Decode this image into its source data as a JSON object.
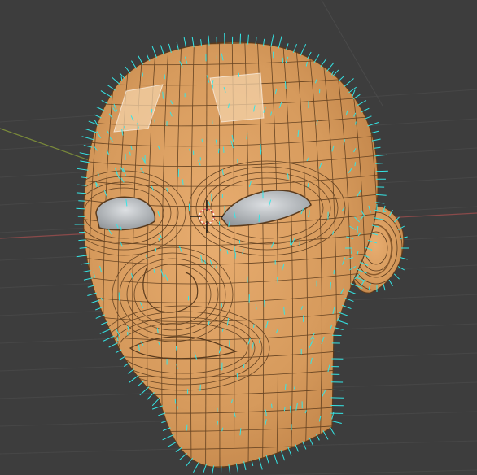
{
  "viewport": {
    "background": "#3d3d3d",
    "grid_color": "#4a4a4a",
    "axis_x_color": "#8a4a4a",
    "axis_y_color": "#7a8a3a",
    "mesh_face_color": "#d69a5c",
    "mesh_edge_color": "#5a3a1c",
    "normal_color": "#35e6e6",
    "selected_face_color": "#f3d2a8",
    "eye_color": "#b8bcc0",
    "cursor_color": "#e05050"
  },
  "object": {
    "kind": "head-mesh",
    "selected_faces": 2,
    "shows_vertex_normals": true
  },
  "cursor": {
    "icon": "3d-cursor-icon"
  }
}
